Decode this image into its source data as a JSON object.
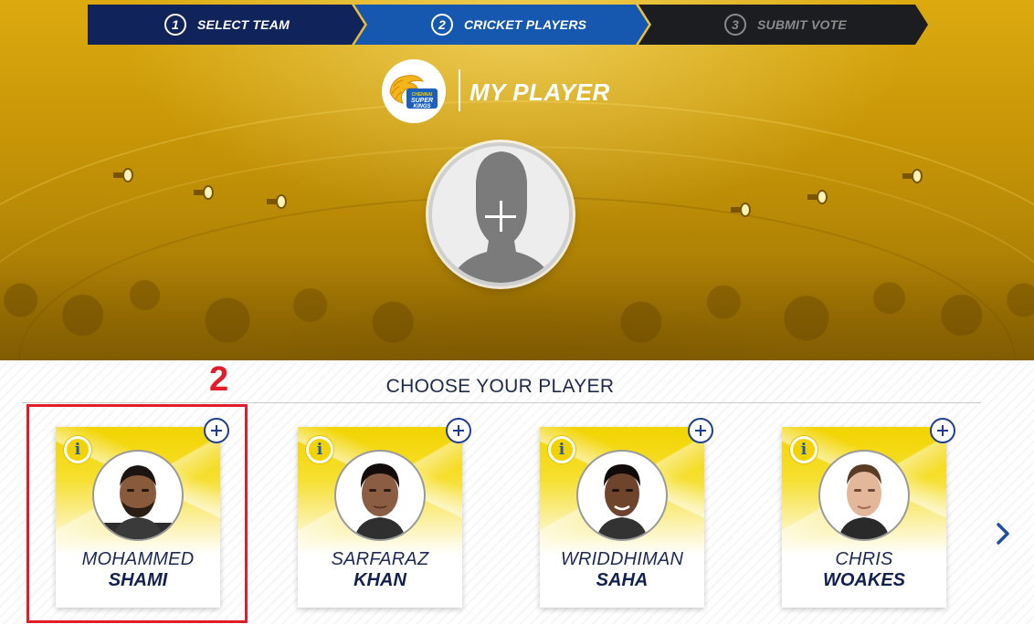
{
  "stepper": {
    "steps": [
      {
        "number": "1",
        "label": "SELECT TEAM",
        "state": "completed"
      },
      {
        "number": "2",
        "label": "CRICKET PLAYERS",
        "state": "active"
      },
      {
        "number": "3",
        "label": "SUBMIT VOTE",
        "state": "pending"
      }
    ]
  },
  "header": {
    "logo_name": "chennai-super-kings-logo",
    "logo_text_top": "CHENNAI",
    "logo_text_mid": "SUPER",
    "logo_text_bottom": "KINGS",
    "title": "MY PLAYER"
  },
  "selected_slot": {
    "icon": "plus-icon"
  },
  "choose": {
    "title": "CHOOSE YOUR PLAYER",
    "annotation_number": "2",
    "players": [
      {
        "first": "MOHAMMED",
        "last": "SHAMI",
        "skin": "#8a5a3c",
        "hair": "#1b1410",
        "beard": true
      },
      {
        "first": "SARFARAZ",
        "last": "KHAN",
        "skin": "#8b5e44",
        "hair": "#120d0a",
        "beard": false
      },
      {
        "first": "WRIDDHIMAN",
        "last": "SAHA",
        "skin": "#6e452c",
        "hair": "#100b08",
        "beard": false
      },
      {
        "first": "CHRIS",
        "last": "WOAKES",
        "skin": "#e2b79a",
        "hair": "#5a3c25",
        "beard": false
      }
    ],
    "info_icon_label": "i",
    "next_icon": "chevron-right-icon"
  },
  "colors": {
    "accent_yellow": "#f2d400",
    "navy": "#10235a",
    "active_blue": "#1657b0",
    "annotation_red": "#e11d2a"
  }
}
